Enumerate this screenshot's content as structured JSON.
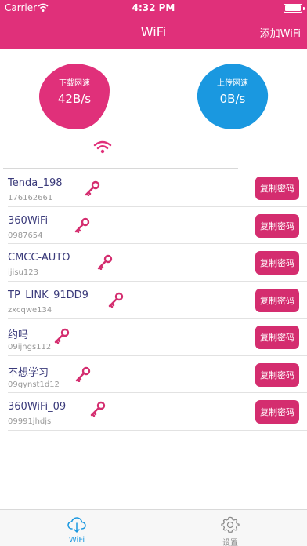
{
  "status_bar": {
    "carrier": "Carrier",
    "time": "4:32 PM"
  },
  "nav": {
    "title": "WiFi",
    "add_button": "添加WiFi"
  },
  "speeds": {
    "download": {
      "label": "下载网速",
      "value": "42B/s",
      "color": "#e0307a"
    },
    "upload": {
      "label": "上传网速",
      "value": "0B/s",
      "color": "#1a98e0"
    }
  },
  "wifi_list": [
    {
      "ssid": "Tenda_198",
      "password": "176162661"
    },
    {
      "ssid": "360WiFi",
      "password": "0987654"
    },
    {
      "ssid": "CMCC-AUTO",
      "password": "ijisu123"
    },
    {
      "ssid": "TP_LINK_91DD9",
      "password": "zxcqwe134"
    },
    {
      "ssid": "约吗",
      "password": "09ijngs112"
    },
    {
      "ssid": "不想学习",
      "password": "09gynst1d12"
    },
    {
      "ssid": "360WiFi_09",
      "password": "09991jhdjs"
    }
  ],
  "copy_button_label": "复制密码",
  "icons": {
    "key": "key-icon",
    "wifi": "wifi-icon",
    "cloud": "cloud-download-icon",
    "settings": "gear-icon"
  },
  "accent_color": "#e0307a",
  "tabs": [
    {
      "label": "WiFi",
      "active": true
    },
    {
      "label": "设置",
      "active": false
    }
  ]
}
